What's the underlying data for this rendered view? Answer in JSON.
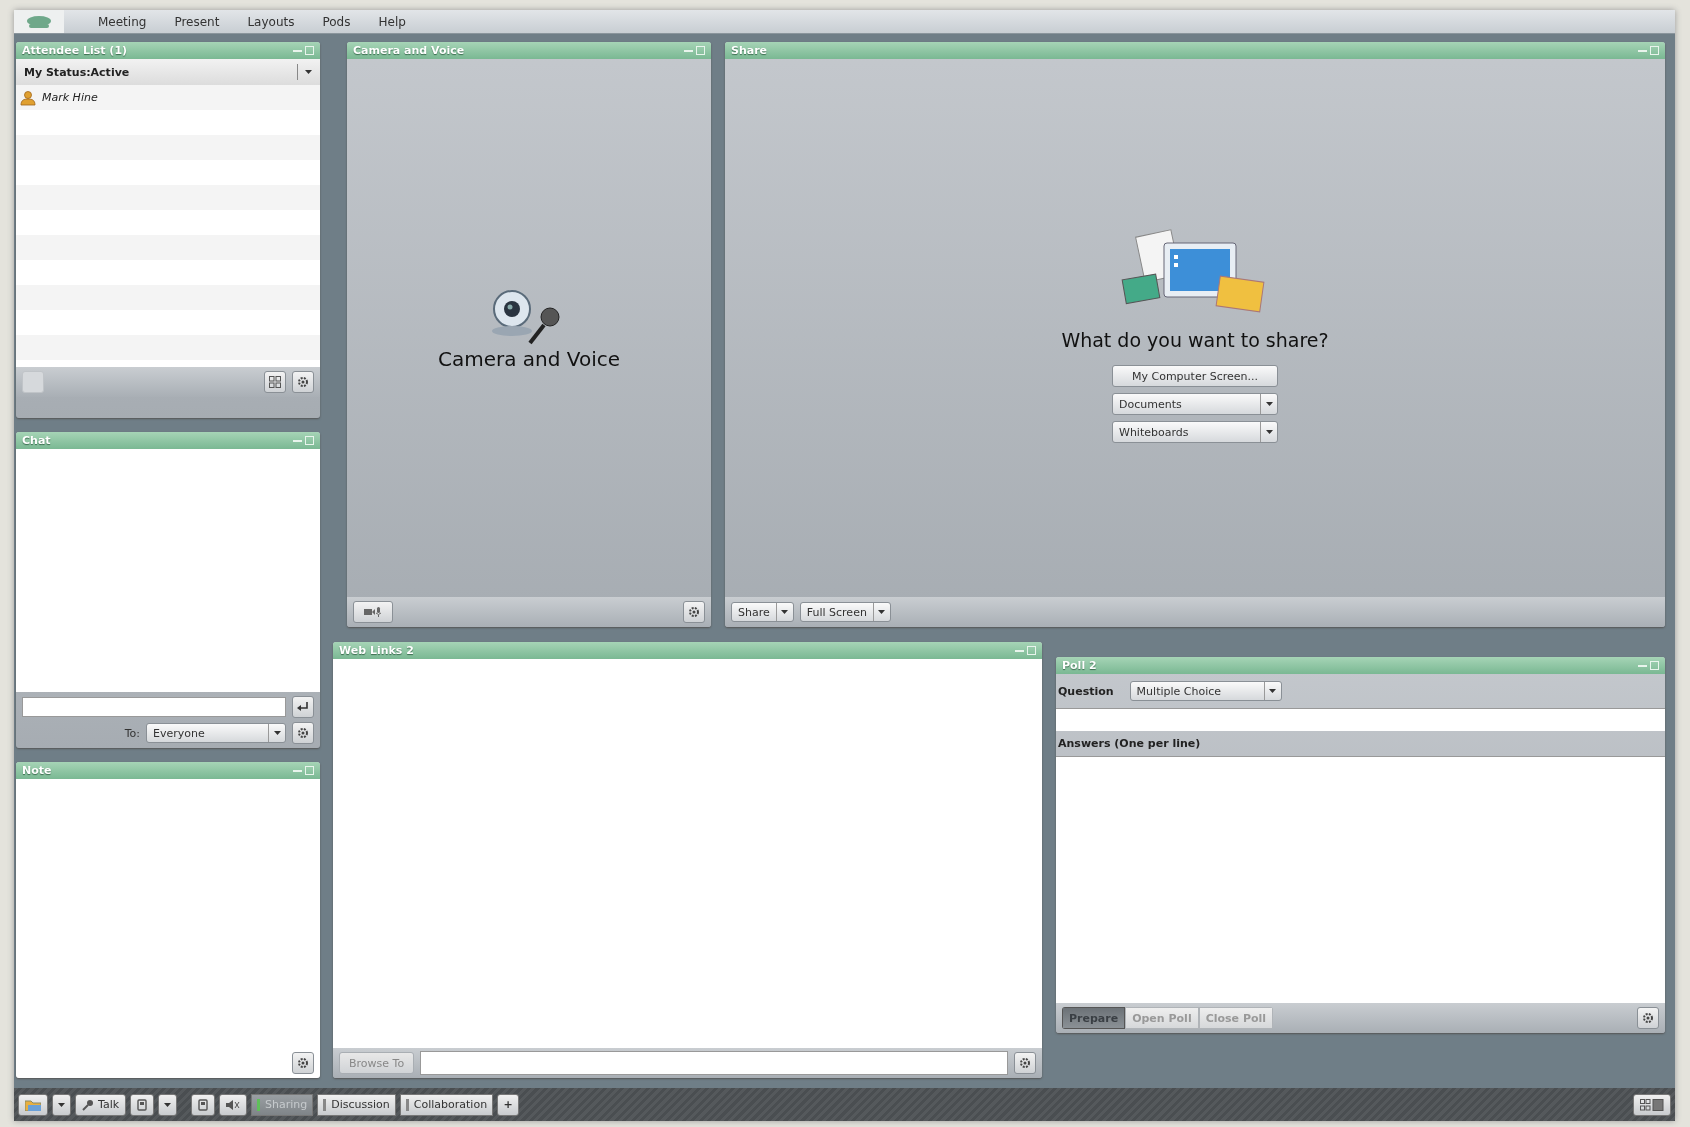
{
  "menu": {
    "items": [
      {
        "label": "Meeting"
      },
      {
        "label": "Present"
      },
      {
        "label": "Layouts"
      },
      {
        "label": "Pods"
      },
      {
        "label": "Help"
      }
    ]
  },
  "attendee_pod": {
    "title": "Attendee List (1)",
    "status": "My Status:Active",
    "attendees": [
      {
        "name": "Mark Hine"
      }
    ]
  },
  "chat_pod": {
    "title": "Chat",
    "to_label": "To:",
    "recipient": "Everyone"
  },
  "note_pod": {
    "title": "Note"
  },
  "camera_pod": {
    "title": "Camera and Voice",
    "label": "Camera and Voice"
  },
  "share_pod": {
    "title": "Share",
    "prompt": "What do you want to share?",
    "options": [
      {
        "label": "My Computer Screen...",
        "kind": "button"
      },
      {
        "label": "Documents",
        "kind": "dropdown"
      },
      {
        "label": "Whiteboards",
        "kind": "dropdown"
      }
    ],
    "footer_buttons": [
      {
        "label": "Share"
      },
      {
        "label": "Full Screen"
      }
    ]
  },
  "web_links_pod": {
    "title": "Web Links 2",
    "browse_button": "Browse To"
  },
  "poll_pod": {
    "title": "Poll 2",
    "question_label": "Question",
    "question_type": "Multiple Choice",
    "answers_label": "Answers (One per line)",
    "tabs": [
      {
        "label": "Prepare",
        "selected": true
      },
      {
        "label": "Open Poll",
        "selected": false
      },
      {
        "label": "Close Poll",
        "selected": false
      }
    ]
  },
  "bottom_bar": {
    "talk_button": "Talk",
    "layout_tabs": [
      {
        "label": "Sharing",
        "selected": true
      },
      {
        "label": "Discussion",
        "selected": false
      },
      {
        "label": "Collaboration",
        "selected": false
      }
    ],
    "add_button": "+"
  }
}
